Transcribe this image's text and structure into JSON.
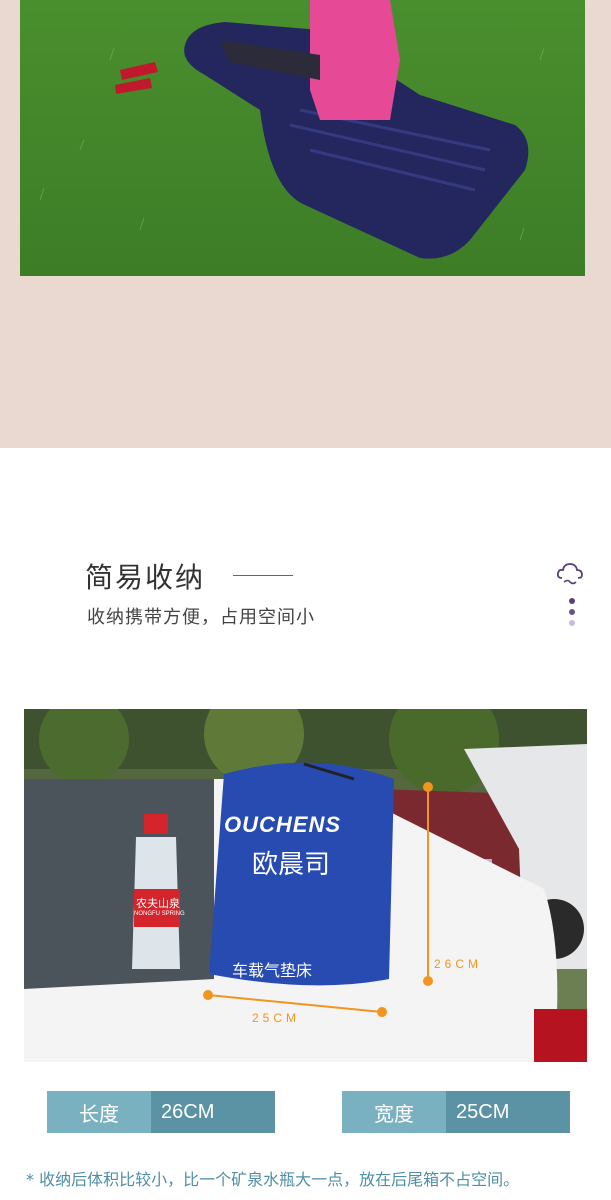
{
  "section": {
    "title": "简易收纳",
    "subtitle": "收纳携带方便，占用空间小"
  },
  "photo": {
    "bag_brand": "OUCHENS",
    "bag_brand_cn": "欧晨司",
    "bag_caption": "车载气垫床",
    "bottle_brand": "农夫山泉",
    "bottle_brand_en": "NONGFU SPRING",
    "dim_height": "26CM",
    "dim_width": "25CM"
  },
  "specs": {
    "length_label": "长度",
    "length_value": "26CM",
    "width_label": "宽度",
    "width_value": "25CM"
  },
  "note": "* 收纳后体积比较小，比一个矿泉水瓶大一点，放在后尾箱不占空间。",
  "colors": {
    "top_band": "#ead9d1",
    "spec_label": "#7ab1c1",
    "spec_value": "#5b93a4",
    "note_text": "#4f8fa6",
    "dimension_accent": "#f0961e"
  },
  "icons": [
    "cloud-icon"
  ]
}
